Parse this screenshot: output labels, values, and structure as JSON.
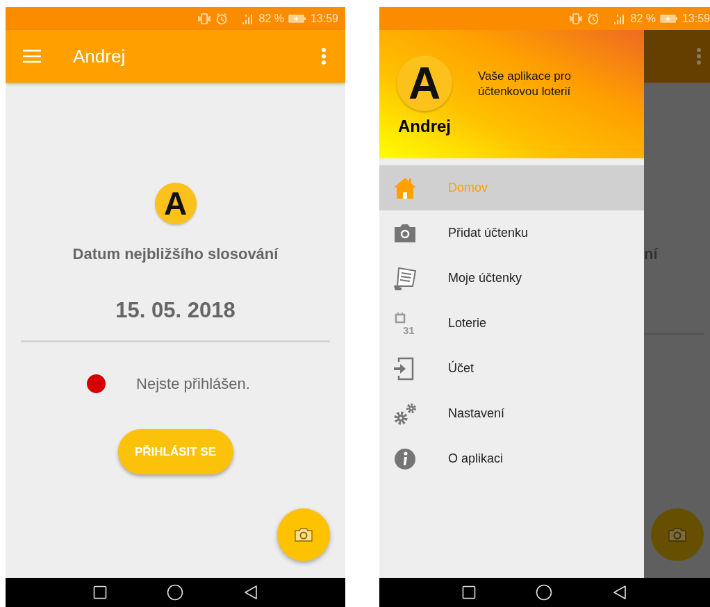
{
  "screens": [
    {
      "kind": "home",
      "status_bar": {
        "battery": "82 %",
        "time": "13:59"
      },
      "app_bar": {
        "title": "Andrej"
      },
      "home": {
        "logo_letter": "A",
        "heading": "Datum nejbližšího slosování",
        "date": "15. 05. 2018",
        "login_status": {
          "text": "Nejste přihlášen.",
          "signed_in": false
        },
        "button": "PŘIHLÁSIT SE"
      }
    },
    {
      "kind": "drawer",
      "status_bar": {
        "battery": "82 %",
        "time": "13:59"
      },
      "drawer": {
        "logo_letter": "A",
        "user_name": "Andrej",
        "tagline": "Vaše aplikace pro účtenkovou loterií",
        "items": [
          {
            "kind": "home",
            "label": "Domov",
            "selected": true
          },
          {
            "kind": "camera",
            "label": "Přidat účtenku",
            "selected": false
          },
          {
            "kind": "receipt",
            "label": "Moje účtenky",
            "selected": false
          },
          {
            "kind": "calendar",
            "label": "Loterie",
            "badge": "31",
            "selected": false
          },
          {
            "kind": "sign-in",
            "label": "Účet",
            "selected": false
          },
          {
            "kind": "gears",
            "label": "Nastavení",
            "selected": false
          },
          {
            "kind": "info",
            "label": "O aplikaci",
            "selected": false
          }
        ]
      },
      "behind": {
        "title_fragment": "ní"
      }
    }
  ]
}
